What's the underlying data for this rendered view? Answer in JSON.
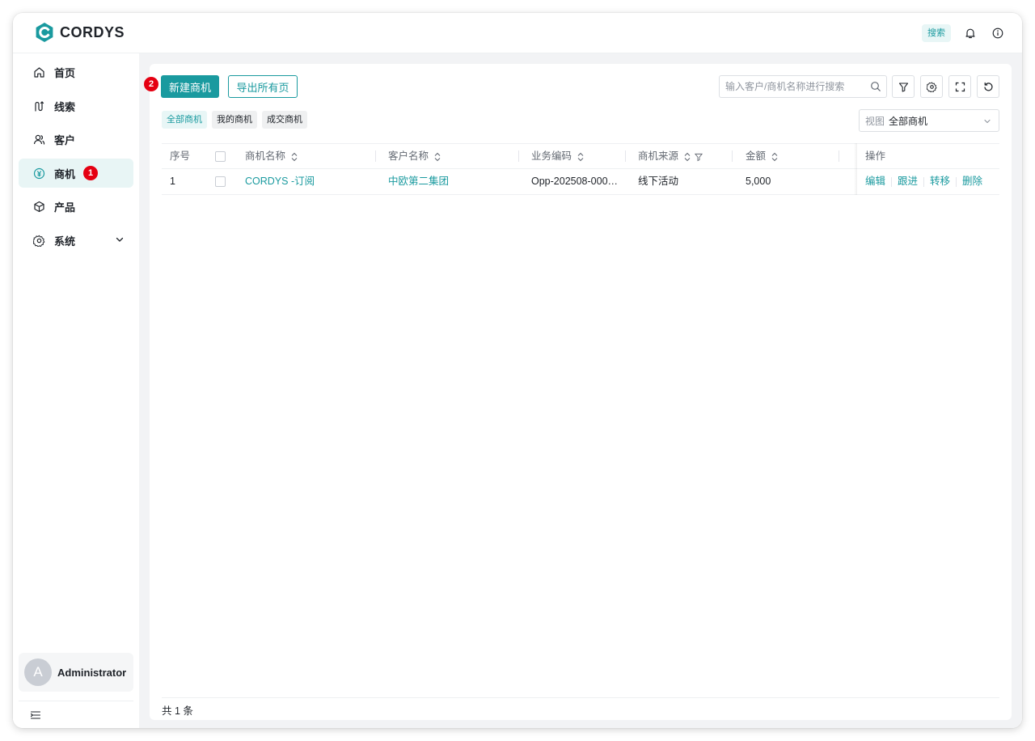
{
  "brand": {
    "name": "CORDYS",
    "color": "#1a9a9f"
  },
  "topbar": {
    "search_label": "搜索",
    "icons": [
      "bell-icon",
      "info-icon"
    ]
  },
  "sidebar": {
    "items": [
      {
        "label": "首页",
        "icon": "home-icon"
      },
      {
        "label": "线索",
        "icon": "leads-icon"
      },
      {
        "label": "客户",
        "icon": "customer-icon"
      },
      {
        "label": "商机",
        "icon": "opportunity-icon",
        "active": true,
        "badge": "1"
      },
      {
        "label": "产品",
        "icon": "product-icon"
      },
      {
        "label": "系统",
        "icon": "settings-icon",
        "expandable": true
      }
    ],
    "user": {
      "avatar_letter": "A",
      "name": "Administrator"
    }
  },
  "toolbar": {
    "new_button_label": "新建商机",
    "new_button_badge": "2",
    "export_button_label": "导出所有页",
    "search_placeholder": "输入客户/商机名称进行搜索"
  },
  "tabs": [
    {
      "label": "全部商机",
      "active": true
    },
    {
      "label": "我的商机"
    },
    {
      "label": "成交商机"
    }
  ],
  "view_select": {
    "prefix": "视图",
    "value": "全部商机"
  },
  "table": {
    "headers": {
      "index": "序号",
      "name": "商机名称",
      "customer": "客户名称",
      "code": "业务编码",
      "source": "商机来源",
      "amount": "金额",
      "ops": "操作"
    },
    "rows": [
      {
        "index": "1",
        "name": "CORDYS -订阅",
        "customer": "中欧第二集团",
        "code": "Opp-202508-000…",
        "source": "线下活动",
        "amount": "5,000"
      }
    ],
    "row_actions": [
      "编辑",
      "跟进",
      "转移",
      "删除"
    ]
  },
  "footer": {
    "total": "共 1 条"
  }
}
